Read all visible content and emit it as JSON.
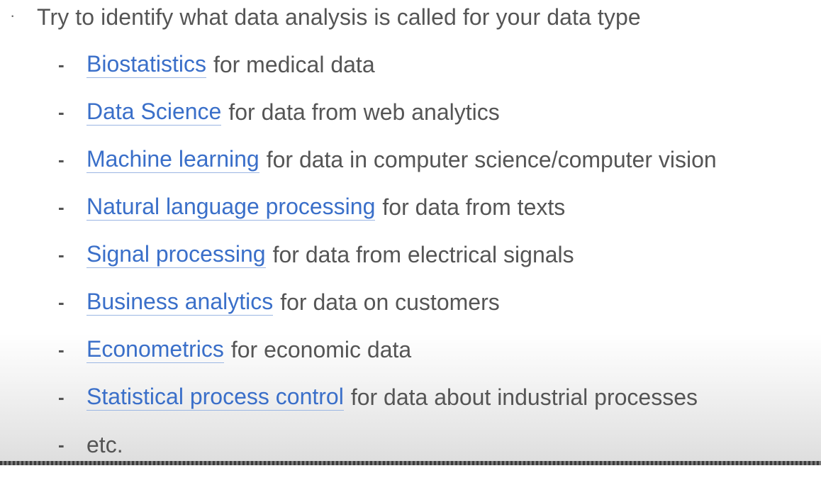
{
  "slide": {
    "top_bullet": {
      "bullet": "·",
      "text": "Try to identify what data analysis is called for your data type"
    },
    "items": [
      {
        "dash": "-",
        "link": "Biostatistics",
        "rest": "for medical data"
      },
      {
        "dash": "-",
        "link": "Data Science",
        "rest": "for data from web analytics"
      },
      {
        "dash": "-",
        "link": "Machine learning",
        "rest": "for data in computer science/computer vision"
      },
      {
        "dash": "-",
        "link": "Natural language processing",
        "rest": "for data from texts"
      },
      {
        "dash": "-",
        "link": "Signal processing",
        "rest": "for data from electrical signals"
      },
      {
        "dash": "-",
        "link": "Business analytics",
        "rest": "for data on customers"
      },
      {
        "dash": "-",
        "link": "Econometrics",
        "rest": "for economic data"
      },
      {
        "dash": "-",
        "link": "Statistical process control",
        "rest": "for data about industrial processes"
      },
      {
        "dash": "-",
        "link": "",
        "rest": "etc."
      }
    ]
  },
  "colors": {
    "link": "#3a6fc9",
    "text": "#555555"
  }
}
